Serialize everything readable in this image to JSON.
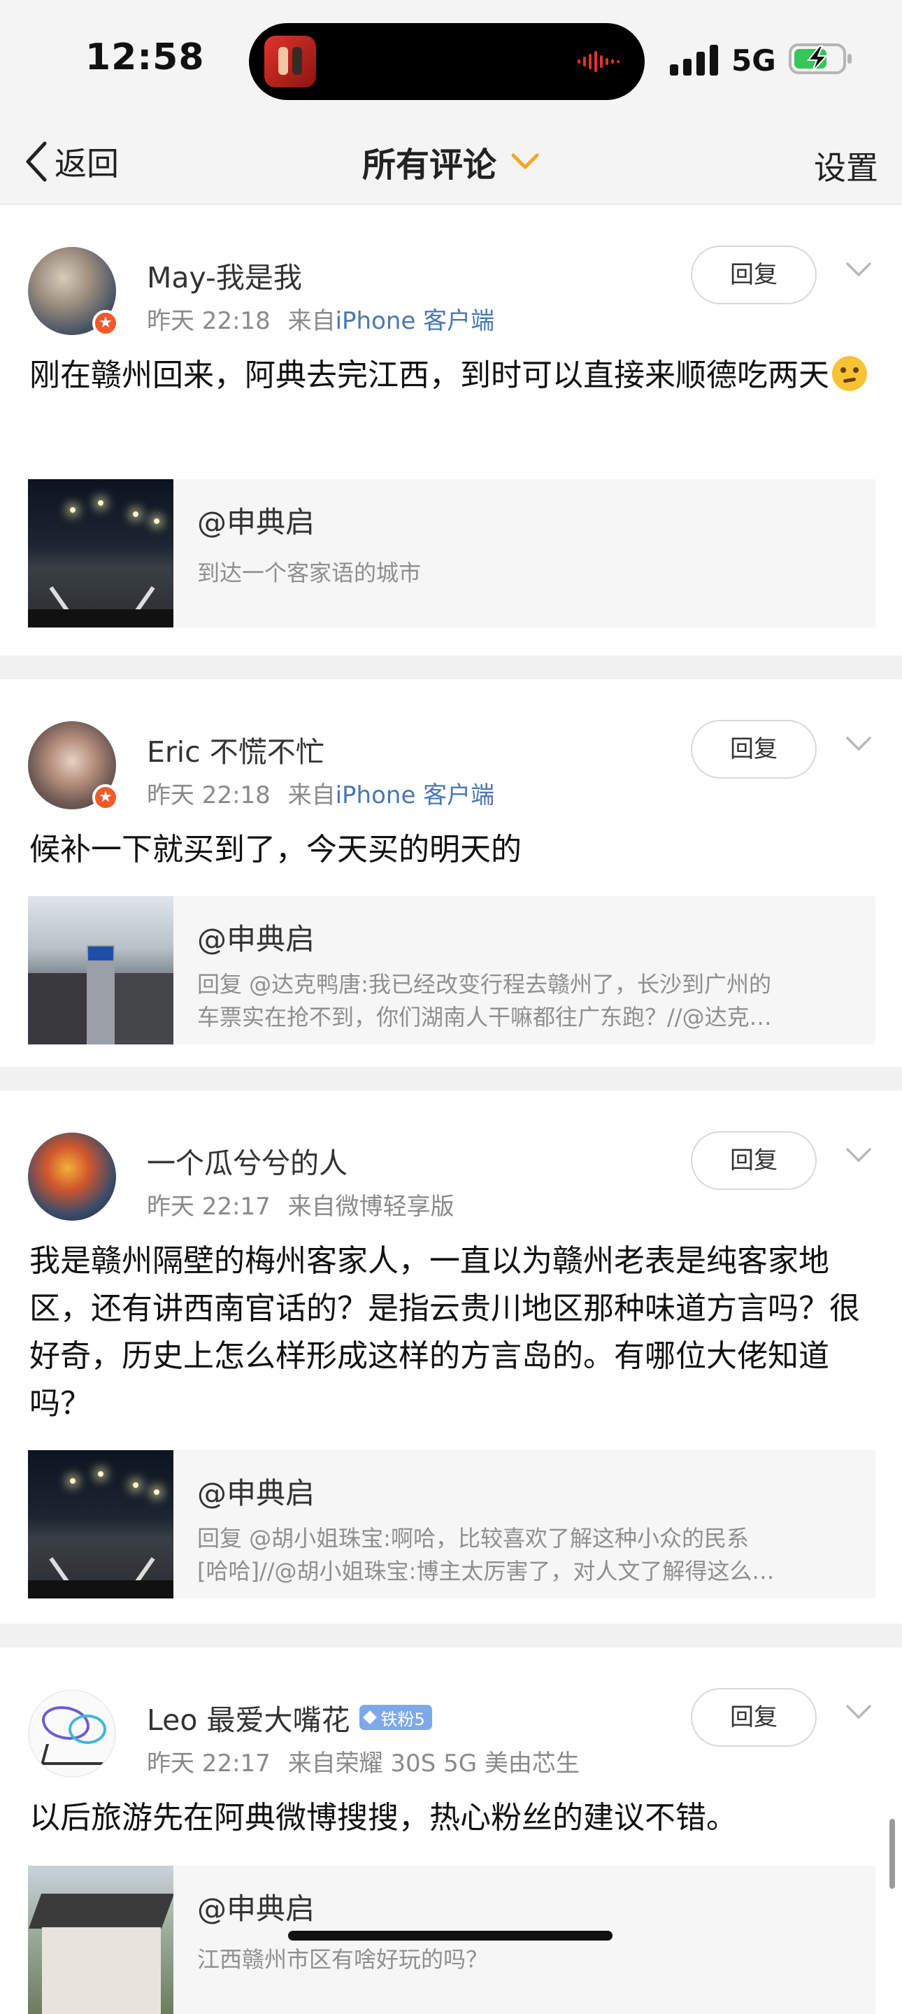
{
  "status_bar": {
    "time": "12:58",
    "network": "5G",
    "accent_color": "#d93a2b",
    "battery_color": "#35c759"
  },
  "nav": {
    "back_label": "返回",
    "title": "所有评论",
    "settings_label": "设置",
    "title_arrow_color": "#f5a623"
  },
  "comments": [
    {
      "username": "May-我是我",
      "time": "昨天 22:18",
      "source_prefix": "来自",
      "source": "iPhone 客户端",
      "reply_label": "回复",
      "text": "刚在赣州回来，阿典去完江西，到时可以直接来顺德吃两天",
      "emoji": "thinking-emoji",
      "ref_title": "@申典启",
      "ref_desc": [
        "到达一个客家语的城市"
      ],
      "thumb": "night-road"
    },
    {
      "username": "Eric 不慌不忙",
      "time": "昨天 22:18",
      "source_prefix": "来自",
      "source": "iPhone 客户端",
      "reply_label": "回复",
      "text": "候补一下就买到了，今天买的明天的",
      "ref_title": "@申典启",
      "ref_desc": [
        "回复 @达克鸭唐:我已经改变行程去赣州了，长沙到广州的",
        "车票实在抢不到，你们湖南人干嘛都往广东跑？//@达克…"
      ],
      "thumb": "train-interior"
    },
    {
      "username": "一个瓜兮兮的人",
      "time": "昨天 22:17",
      "source_prefix": "来自",
      "source": "微博轻享版",
      "reply_label": "回复",
      "text": "我是赣州隔壁的梅州客家人，一直以为赣州老表是纯客家地区，还有讲西南官话的？是指云贵川地区那种味道方言吗？很好奇，历史上怎么样形成这样的方言岛的。有哪位大佬知道吗？",
      "ref_title": "@申典启",
      "ref_desc": [
        "回复 @胡小姐珠宝:啊哈，比较喜欢了解这种小众的民系",
        "[哈哈]//@胡小姐珠宝:博主太厉害了，对人文了解得这么…"
      ],
      "thumb": "night-road"
    },
    {
      "username": "Leo 最爱大嘴花",
      "badge": "铁粉5",
      "time": "昨天 22:17",
      "source_prefix": "来自",
      "source": "荣耀 30S 5G 美由芯生",
      "reply_label": "回复",
      "text": "以后旅游先在阿典微博搜搜，热心粉丝的建议不错。",
      "ref_title": "@申典启",
      "ref_desc": [
        "江西赣州市区有啥好玩的吗？"
      ],
      "thumb": "house"
    }
  ]
}
